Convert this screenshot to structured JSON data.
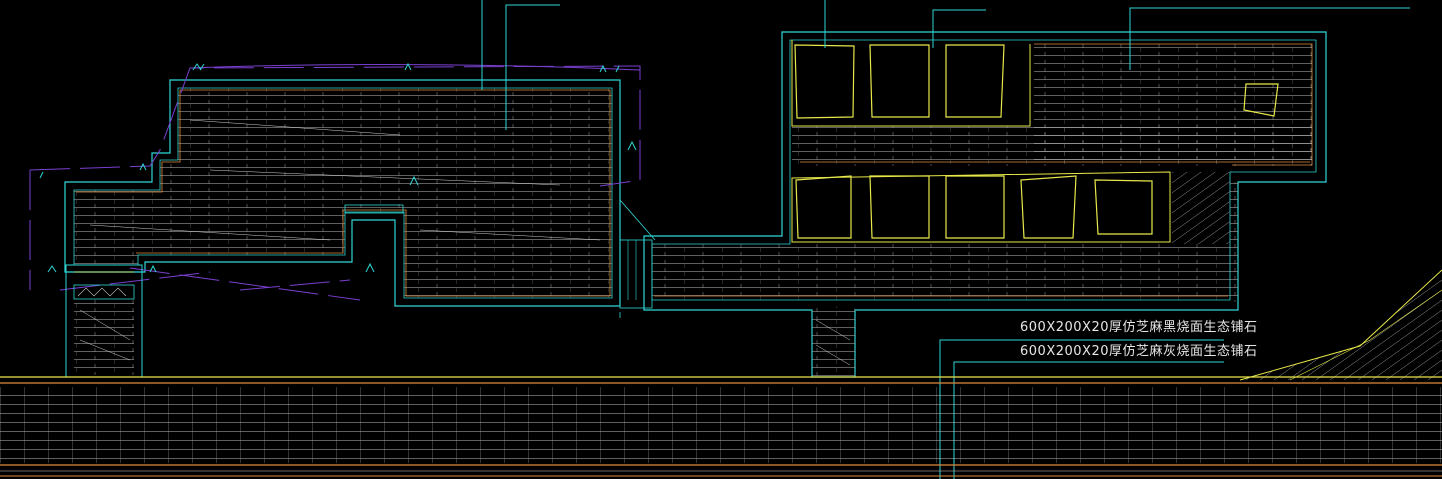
{
  "colors": {
    "background": "#000000",
    "outline_cyan": "#2fd6d6",
    "paving_grid": "#c8c8c8",
    "edge_orange": "#e08a3c",
    "window_yellow": "#e8e84a",
    "boundary_purple": "#7a3fd0",
    "annotation_text": "#e6e6e6"
  },
  "annotations": [
    {
      "id": "black-paver",
      "text": "600X200X20厚仿芝麻黑烧面生态铺石"
    },
    {
      "id": "grey-paver",
      "text": "600X200X20厚仿芝麻灰烧面生态铺石"
    }
  ]
}
